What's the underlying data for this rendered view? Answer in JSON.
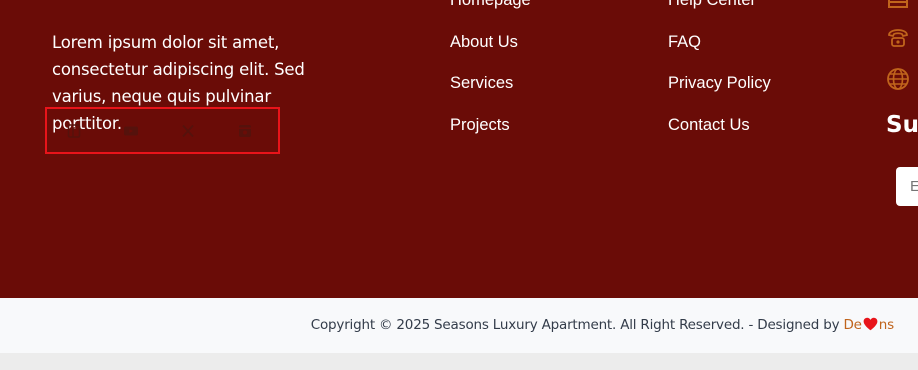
{
  "footer": {
    "about": "Lorem ipsum dolor sit amet, consectetur adipiscing elit. Sed varius, neque quis pulvinar porttitor.",
    "social_icons": [
      "facebook-icon",
      "youtube-icon",
      "x-icon",
      "instagram-icon"
    ],
    "quick_links": [
      "Homepage",
      "About Us",
      "Services",
      "Projects"
    ],
    "support_links": [
      "Help Center",
      "FAQ",
      "Privacy Policy",
      "Contact Us"
    ],
    "contact_icons": [
      "map-marker-icon",
      "phone-icon",
      "globe-icon"
    ],
    "subscribe": {
      "title": "Subscribe",
      "placeholder": "Email"
    }
  },
  "copyright": {
    "text": "Copyright © 2025 Seasons Luxury Apartment. All Right Reserved. - Designed by ",
    "brand_start": "De",
    "brand_end": "ns"
  },
  "colors": {
    "footer_bg": "#6a0c07",
    "accent": "#c0641c",
    "highlight_border": "#e8141a",
    "heart": "#e8141a"
  }
}
